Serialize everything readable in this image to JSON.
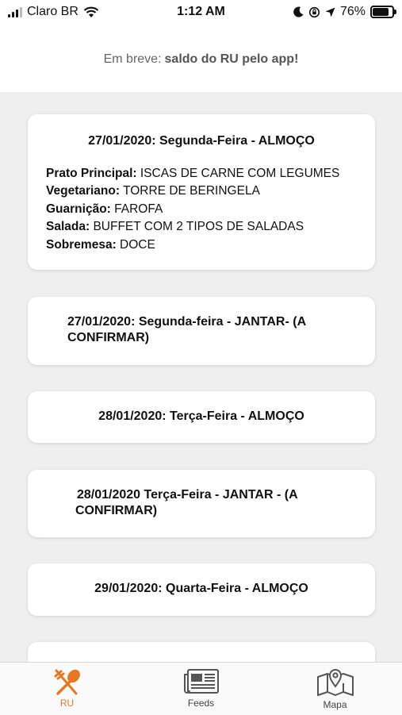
{
  "status_bar": {
    "carrier": "Claro BR",
    "time": "1:12 AM",
    "battery": "76%",
    "battery_level": 0.76
  },
  "notice": {
    "prefix": "Em breve:",
    "highlight": "saldo do RU pelo app!"
  },
  "cards": [
    {
      "title": "27/01/2020: Segunda-Feira - ALMOÇO",
      "details": [
        {
          "label": "Prato Principal:",
          "value": "ISCAS DE CARNE COM LEGUMES"
        },
        {
          "label": "Vegetariano:",
          "value": "TORRE DE BERINGELA"
        },
        {
          "label": "Guarnição:",
          "value": "FAROFA"
        },
        {
          "label": "Salada:",
          "value": "BUFFET COM 2 TIPOS DE SALADAS"
        },
        {
          "label": "Sobremesa:",
          "value": "DOCE"
        }
      ]
    },
    {
      "title_line1": "27/01/2020: Segunda-feira - JANTAR- (A",
      "title_line2": "CONFIRMAR)"
    },
    {
      "title": "28/01/2020: Terça-Feira - ALMOÇO"
    },
    {
      "title_line1": "28/01/2020 Terça-Feira - JANTAR - (A",
      "title_line2": "CONFIRMAR)"
    },
    {
      "title": "29/01/2020: Quarta-Feira - ALMOÇO"
    }
  ],
  "tabs": [
    {
      "label": "RU",
      "icon": "utensils-icon",
      "active": true
    },
    {
      "label": "Feeds",
      "icon": "newspaper-icon",
      "active": false
    },
    {
      "label": "Mapa",
      "icon": "map-pin-icon",
      "active": false
    }
  ],
  "colors": {
    "accent": "#e87722",
    "background": "#efefef",
    "card": "#ffffff"
  }
}
